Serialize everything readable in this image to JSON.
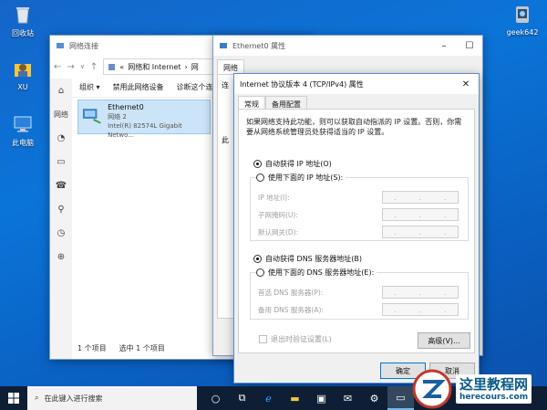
{
  "desktop": {
    "icons": [
      {
        "label": "回收站"
      },
      {
        "label": "XU"
      },
      {
        "label": "此电脑"
      },
      {
        "label": "geek642"
      }
    ]
  },
  "net_window": {
    "title": "网络连接",
    "address": "网络和 Internet",
    "address_sep": "«",
    "address_more": "网",
    "commands": [
      "组织 ▾",
      "禁用此网络设备",
      "诊断这个连"
    ],
    "adapter": {
      "name": "Ethernet0",
      "network": "网络 2",
      "device": "Intel(R) 82574L Gigabit Netwo..."
    },
    "status_count": "1 个项目",
    "status_selected": "选中 1 个项目",
    "left_label": "网络"
  },
  "eth_window": {
    "title": "Ethernet0 属性",
    "tab": "网络",
    "side_chars": [
      "连",
      "此"
    ]
  },
  "ipv4_dialog": {
    "title": "Internet 协议版本 4 (TCP/IPv4) 属性",
    "tabs": [
      "常规",
      "备用配置"
    ],
    "description": "如果网络支持此功能，则可以获取自动指派的 IP 设置。否则，你需要从网络系统管理员处获得适当的 IP 设置。",
    "ip_auto": "自动获得 IP 地址(O)",
    "ip_manual": "使用下面的 IP 地址(S):",
    "ip_fields": [
      "IP 地址(I):",
      "子网掩码(U):",
      "默认网关(D):"
    ],
    "dns_auto": "自动获得 DNS 服务器地址(B)",
    "dns_manual": "使用下面的 DNS 服务器地址(E):",
    "dns_fields": [
      "首选 DNS 服务器(P):",
      "备用 DNS 服务器(A):"
    ],
    "validate": "退出时验证设置(L)",
    "advanced": "高级(V)...",
    "ok": "确定",
    "cancel": "取消"
  },
  "taskbar": {
    "search_placeholder": "在此键入进行搜索"
  },
  "watermark": {
    "cn": "这里教程网",
    "en": "herecours.com"
  },
  "colors": {
    "accent": "#0078d7",
    "desktop": "#0b74d8",
    "taskbar": "#0e1f35"
  }
}
